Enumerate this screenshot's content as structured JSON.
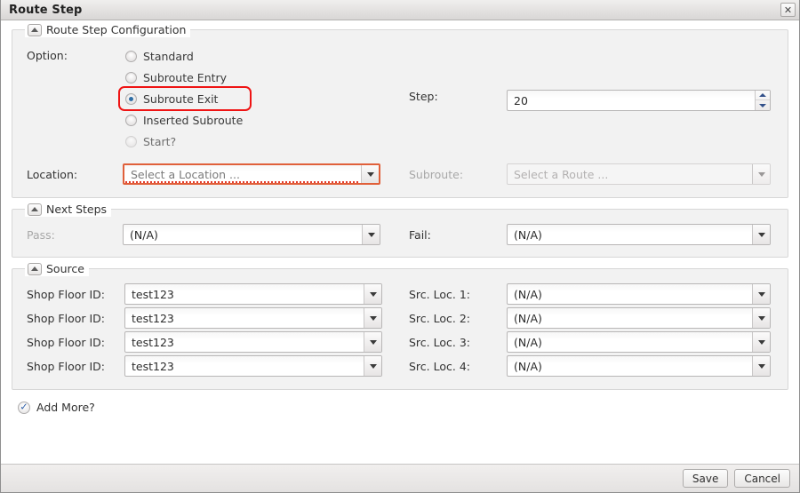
{
  "window": {
    "title": "Route Step",
    "close_icon": "close-icon"
  },
  "config_panel": {
    "title": "Route Step Configuration",
    "collapse_icon": "collapse-triangle-icon",
    "option_label": "Option:",
    "options": [
      {
        "label": "Standard",
        "checked": false,
        "disabled": false
      },
      {
        "label": "Subroute Entry",
        "checked": false,
        "disabled": false
      },
      {
        "label": "Subroute Exit",
        "checked": true,
        "disabled": false,
        "highlighted": true
      },
      {
        "label": "Inserted Subroute",
        "checked": false,
        "disabled": false
      },
      {
        "label": "Start?",
        "checked": false,
        "disabled": true
      }
    ],
    "step_label": "Step:",
    "step_value": "20",
    "location_label": "Location:",
    "location_placeholder": "Select a Location ...",
    "location_invalid": true,
    "subroute_label": "Subroute:",
    "subroute_placeholder": "Select a Route ...",
    "subroute_disabled": true
  },
  "next_steps_panel": {
    "title": "Next Steps",
    "collapse_icon": "collapse-triangle-icon",
    "pass_label": "Pass:",
    "pass_value": "(N/A)",
    "pass_label_disabled": true,
    "fail_label": "Fail:",
    "fail_value": "(N/A)"
  },
  "source_panel": {
    "title": "Source",
    "collapse_icon": "collapse-triangle-icon",
    "rows": [
      {
        "left_label": "Shop Floor ID:",
        "left_value": "test123",
        "right_label": "Src. Loc. 1:",
        "right_value": "(N/A)"
      },
      {
        "left_label": "Shop Floor ID:",
        "left_value": "test123",
        "right_label": "Src. Loc. 2:",
        "right_value": "(N/A)"
      },
      {
        "left_label": "Shop Floor ID:",
        "left_value": "test123",
        "right_label": "Src. Loc. 3:",
        "right_value": "(N/A)"
      },
      {
        "left_label": "Shop Floor ID:",
        "left_value": "test123",
        "right_label": "Src. Loc. 4:",
        "right_value": "(N/A)"
      }
    ]
  },
  "add_more": {
    "label": "Add More?",
    "checked": true,
    "check_glyph": "✓"
  },
  "footer": {
    "save_label": "Save",
    "cancel_label": "Cancel"
  },
  "colors": {
    "highlight_red": "#ef1414",
    "invalid_border": "#e0603a",
    "invalid_underline": "#e23b2b",
    "radio_dot": "#2f6ea5",
    "spinner_arrow": "#32508a",
    "check_blue": "#2c5ea8",
    "panel_bg": "#f2f2f2"
  }
}
